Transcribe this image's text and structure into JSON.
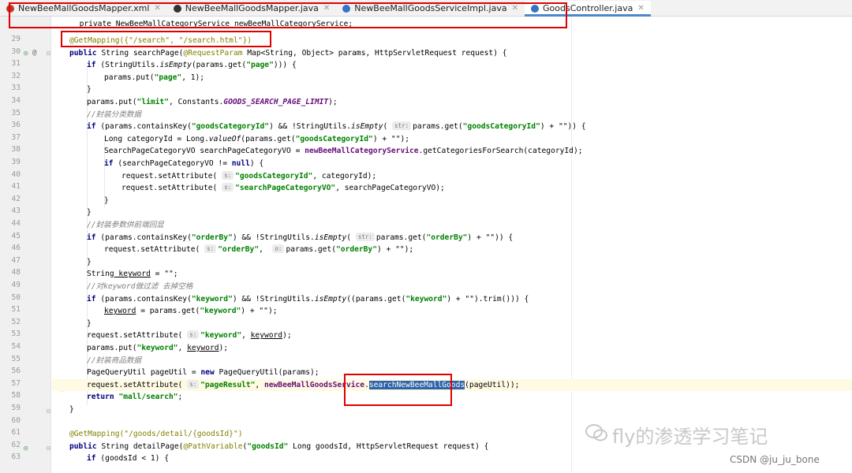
{
  "tabs": [
    {
      "label": "NewBeeMallGoodsMapper.xml",
      "icon": "xml-file-icon",
      "color": "#c0392b",
      "active": false
    },
    {
      "label": "NewBeeMallGoodsMapper.java",
      "icon": "java-interface-icon",
      "color": "#333333",
      "active": false
    },
    {
      "label": "NewBeeMallGoodsServiceImpl.java",
      "icon": "java-class-icon",
      "color": "#3574c4",
      "active": false
    },
    {
      "label": "GoodsController.java",
      "icon": "java-class-icon",
      "color": "#3574c4",
      "active": true
    }
  ],
  "top_partial_line": "private NewBeeMallCategoryService newBeeMallCategoryService;",
  "line_numbers": [
    "29",
    "30",
    "31",
    "32",
    "33",
    "34",
    "35",
    "36",
    "37",
    "38",
    "39",
    "40",
    "41",
    "42",
    "43",
    "44",
    "45",
    "46",
    "47",
    "48",
    "49",
    "50",
    "51",
    "52",
    "53",
    "54",
    "55",
    "56",
    "57",
    "58",
    "59",
    "60",
    "61",
    "62",
    "63"
  ],
  "hints": {
    "str": "str:",
    "s": "s:",
    "o": "o:"
  },
  "tokens": {
    "getmapping_search": "@GetMapping({\"/search\", \"/search.html\"})",
    "public": "public",
    "string": "String",
    "searchPage": "searchPage(",
    "requestParam": "@RequestParam",
    "sig_rest": " Map<String, Object> params, HttpServletRequest request) {",
    "if": "if",
    "stringutils": "(StringUtils.",
    "isEmpty": "isEmpty",
    "params_get_page": "(params.get(",
    "page": "\"page\"",
    "close3": "))) {",
    "params_put": "params.put(",
    "comma_one": ", 1);",
    "brace_close": "}",
    "limit": "\"limit\"",
    "constants": ", Constants.",
    "goods_search_limit": "GOODS_SEARCH_PAGE_LIMIT",
    "close_semi": ");",
    "cmt_category": "//封装分类数据",
    "params_contains": "(params.containsKey(",
    "goodsCategoryId": "\"goodsCategoryId\"",
    "and_not_su": ") && !StringUtils.",
    "paren_open": "(",
    "params_get": "params.get(",
    "plus_empty": ") + \"\")) {",
    "long_categoryId": "Long categoryId = Long.",
    "valueOf": "valueOf",
    "params_get2": "(params.get(",
    "plus_empty_semi": ") + \"\");",
    "spcvo_decl": "SearchPageCategoryVO searchPageCategoryVO = ",
    "nbm_category_service": "newBeeMallCategoryService",
    "get_categories": ".getCategoriesForSearch(categoryId);",
    "spcvo_neq": "(searchPageCategoryVO != ",
    "null": "null",
    "close_brace_open": ") {",
    "request_setattr": "request.setAttribute(",
    "comma_categoryId": ", categoryId);",
    "searchPageCategoryVO": "\"searchPageCategoryVO\"",
    "comma_spcvo": ", searchPageCategoryVO);",
    "cmt_orderby": "//封装参数供前端回显",
    "orderBy": "\"orderBy\"",
    "plus_empty_close": ") + \"\")) {",
    "comma_sp": ",  ",
    "plus_empty_semi2": ") + \"\");",
    "keyword_decl": " keyword",
    "eq_empty": " = \"\";",
    "cmt_keyword": "//对keyword做过滤 去掉空格",
    "keyword_str": "\"keyword\"",
    "and_not_su2": ") && !StringUtils.",
    "paren_params_get": "((params.get(",
    "trim_close": ") + \"\").trim())) {",
    "keyword_var": "keyword",
    "eq_params_get": " = params.get(",
    "comma_space": ", ",
    "comma": ", ",
    "cmt_goods": "//封装商品数据",
    "pqu_decl": "PageQueryUtil pageUtil = ",
    "new": "new",
    "pqu_ctor": " PageQueryUtil(params);",
    "pageResult": "\"pageResult\"",
    "nbm_goods_service": "newBeeMallGoodsService",
    "dot": ".",
    "search_goods": "searchNewBeeMallGoods",
    "page_util_close": "(pageUtil));",
    "return": "return",
    "mall_search": "\"mall/search\"",
    "semi": ";",
    "getmapping_detail": "@GetMapping(\"/goods/detail/{goodsId}\")",
    "detailPage": "detailPage(",
    "pathVariable": "@PathVariable",
    "goodsId_str": "\"goodsId\"",
    "detail_sig_rest": " Long goodsId, HttpServletRequest request) {",
    "goodsId_lt": "(goodsId < 1) {"
  },
  "watermark": {
    "text": "fly的渗透学习笔记",
    "credit": "CSDN @ju_ju_bone"
  }
}
